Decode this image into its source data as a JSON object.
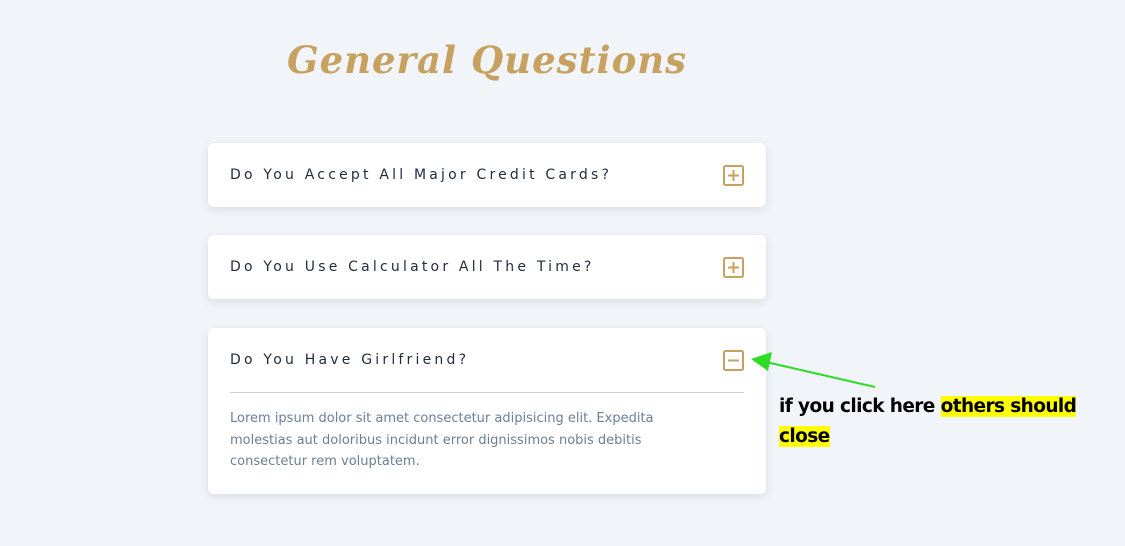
{
  "page": {
    "title": "General Questions"
  },
  "faq": {
    "items": [
      {
        "question": "Do You Accept All Major Credit Cards?",
        "toggle_icon": "plus-square-icon",
        "expanded": false
      },
      {
        "question": "Do You Use Calculator All The Time?",
        "toggle_icon": "plus-square-icon",
        "expanded": false
      },
      {
        "question": "Do You Have Girlfriend?",
        "toggle_icon": "minus-square-icon",
        "expanded": true,
        "answer": "Lorem ipsum dolor sit amet consectetur adipisicing elit. Expedita molestias aut doloribus incidunt error dignissimos nobis debitis consectetur rem voluptatem."
      }
    ]
  },
  "annotation": {
    "text_plain": "if you click here ",
    "text_highlighted": "others should close",
    "arrow_icon": "green-arrow-icon",
    "arrow_color": "#2ddc25",
    "highlight_color": "#ffff00"
  },
  "colors": {
    "background": "#f1f4f8",
    "accent_gold": "#c6a15f",
    "question_text": "#1f2b3d",
    "answer_text": "#6c7f96"
  }
}
